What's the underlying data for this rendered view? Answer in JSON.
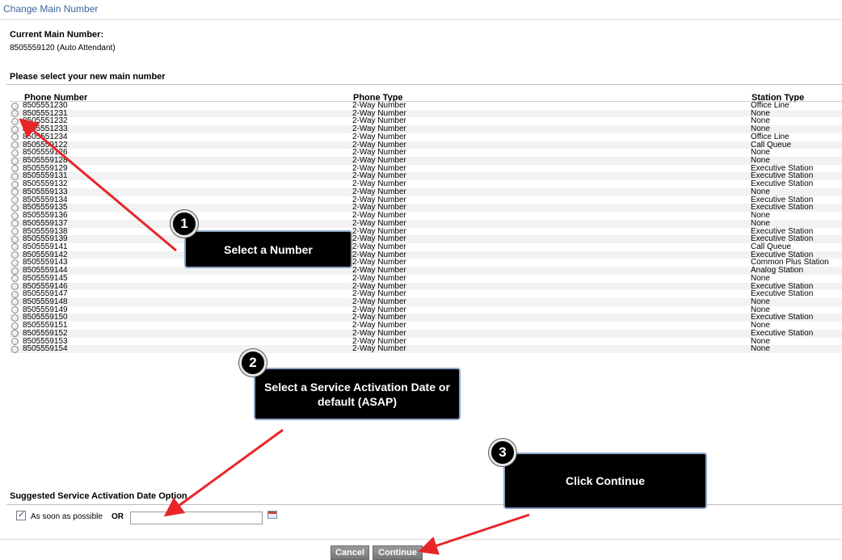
{
  "page": {
    "title": "Change Main Number",
    "current_label": "Current Main Number:",
    "current_value": "8505559120 (Auto Attendant)",
    "select_label": "Please select your new main number"
  },
  "table": {
    "headers": [
      "Phone Number",
      "Phone Type",
      "Station Type"
    ],
    "rows": [
      [
        "8505551230",
        "2-Way Number",
        "Office Line"
      ],
      [
        "8505551231",
        "2-Way Number",
        "None"
      ],
      [
        "8505551232",
        "2-Way Number",
        "None"
      ],
      [
        "8505551233",
        "2-Way Number",
        "None"
      ],
      [
        "8505551234",
        "2-Way Number",
        "Office Line"
      ],
      [
        "8505559122",
        "2-Way Number",
        "Call Queue"
      ],
      [
        "8505559126",
        "2-Way Number",
        "None"
      ],
      [
        "8505559128",
        "2-Way Number",
        "None"
      ],
      [
        "8505559129",
        "2-Way Number",
        "Executive Station"
      ],
      [
        "8505559131",
        "2-Way Number",
        "Executive Station"
      ],
      [
        "8505559132",
        "2-Way Number",
        "Executive Station"
      ],
      [
        "8505559133",
        "2-Way Number",
        "None"
      ],
      [
        "8505559134",
        "2-Way Number",
        "Executive Station"
      ],
      [
        "8505559135",
        "2-Way Number",
        "Executive Station"
      ],
      [
        "8505559136",
        "2-Way Number",
        "None"
      ],
      [
        "8505559137",
        "2-Way Number",
        "None"
      ],
      [
        "8505559138",
        "2-Way Number",
        "Executive Station"
      ],
      [
        "8505559139",
        "2-Way Number",
        "Executive Station"
      ],
      [
        "8505559141",
        "2-Way Number",
        "Call Queue"
      ],
      [
        "8505559142",
        "2-Way Number",
        "Executive Station"
      ],
      [
        "8505559143",
        "2-Way Number",
        "Common Plus Station"
      ],
      [
        "8505559144",
        "2-Way Number",
        "Analog Station"
      ],
      [
        "8505559145",
        "2-Way Number",
        "None"
      ],
      [
        "8505559146",
        "2-Way Number",
        "Executive Station"
      ],
      [
        "8505559147",
        "2-Way Number",
        "Executive Station"
      ],
      [
        "8505559148",
        "2-Way Number",
        "None"
      ],
      [
        "8505559149",
        "2-Way Number",
        "None"
      ],
      [
        "8505559150",
        "2-Way Number",
        "Executive Station"
      ],
      [
        "8505559151",
        "2-Way Number",
        "None"
      ],
      [
        "8505559152",
        "2-Way Number",
        "Executive Station"
      ],
      [
        "8505559153",
        "2-Way Number",
        "None"
      ],
      [
        "8505559154",
        "2-Way Number",
        "None"
      ]
    ]
  },
  "activation": {
    "label": "Suggested Service Activation Date Option",
    "asap_label": "As soon as possible",
    "asap_checked": true,
    "or_label": "OR",
    "date_value": ""
  },
  "buttons": {
    "cancel": "Cancel",
    "continue": "Continue"
  },
  "callouts": [
    {
      "number": "1",
      "text": "Select a Number"
    },
    {
      "number": "2",
      "text": "Select a Service Activation Date or default (ASAP)"
    },
    {
      "number": "3",
      "text": "Click Continue"
    }
  ],
  "colors": {
    "title": "#3a64a0",
    "arrow": "#e8262a",
    "callout_bg": "#000000",
    "callout_border": "#8fa6c8",
    "button": "#8a8a8a"
  },
  "icons": {
    "calendar": "calendar-icon",
    "checkbox": "checkbox-checked-icon"
  }
}
